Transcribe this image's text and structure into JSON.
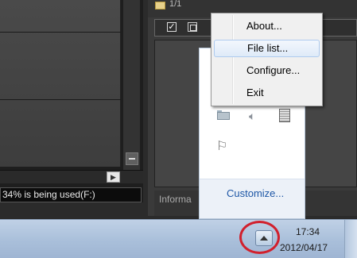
{
  "left_window": {
    "status_text": "34% is being used(F:)"
  },
  "right_window": {
    "title_text": "1/1",
    "info_text": "Informa"
  },
  "context_menu": {
    "items": [
      {
        "label": "About..."
      },
      {
        "label": "File list..."
      },
      {
        "label": "Configure..."
      },
      {
        "label": "Exit"
      }
    ],
    "hovered_item": "File list..."
  },
  "tray_flyout": {
    "icons": [
      "folder-icon",
      "speaker-icon",
      "device-icon",
      "flag-icon"
    ],
    "customize_label": "Customize..."
  },
  "taskbar": {
    "show_hidden_icons": "chevron-up-icon",
    "clock_time": "17:34",
    "clock_date": "2012/04/17"
  },
  "colors": {
    "menu_hover": "#deeaf8",
    "highlight_ring": "#d1202d",
    "customize_link": "#1e57a6",
    "taskbar": "#b3c6de"
  }
}
